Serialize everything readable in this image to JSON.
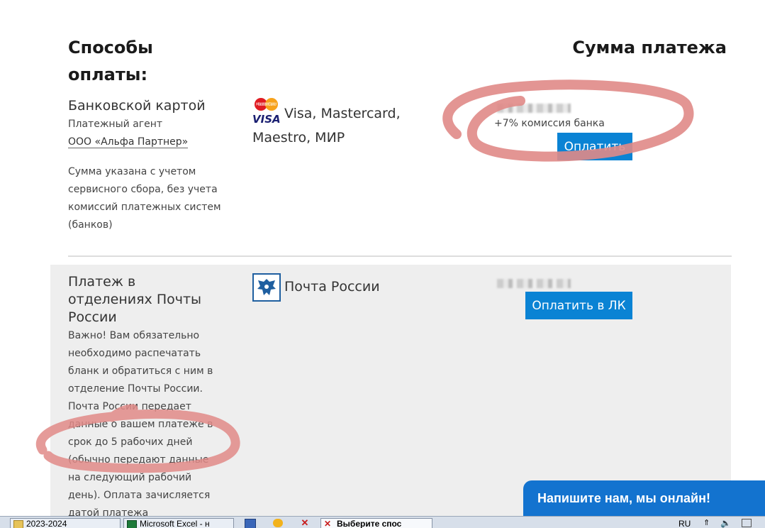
{
  "header": {
    "methods_title": "Способы оплаты:",
    "sum_title": "Сумма платежа"
  },
  "card_method": {
    "title": "Банковской картой",
    "agent_label": "Платежный агент",
    "agent_link": "ООО «Альфа Партнер»",
    "note": "Сумма указана с учетом сервисного сбора, без учета комиссий платежных систем (банков)",
    "networks": "Visa, Mastercard, Maestro, МИР",
    "mastercard_logo_text": "MasterCard",
    "visa_logo_text": "VISA",
    "commission": "+7% комиссия банка",
    "pay_button": "Оплатить"
  },
  "post_method": {
    "title": "Платеж в отделениях Почты России",
    "note": "Важно! Вам обязательно необходимо распечатать бланк и обратиться с ним в отделение Почты России. Почта России передает данные о вашем платеже в срок до 5 рабочих дней (обычно передают данные на следующий рабочий день). Оплата зачисляется датой платежа",
    "provider": "Почта России",
    "pay_button": "Оплатить в ЛК"
  },
  "chat_widget": {
    "label": "Напишите нам, мы онлайн!"
  },
  "taskbar": {
    "items": [
      "2023-2024",
      "Microsoft Excel - н",
      "Выберите спос"
    ],
    "language": "RU"
  },
  "colors": {
    "accent": "#0a83d4",
    "chat": "#1373cf",
    "annotation": "#e08a87"
  }
}
